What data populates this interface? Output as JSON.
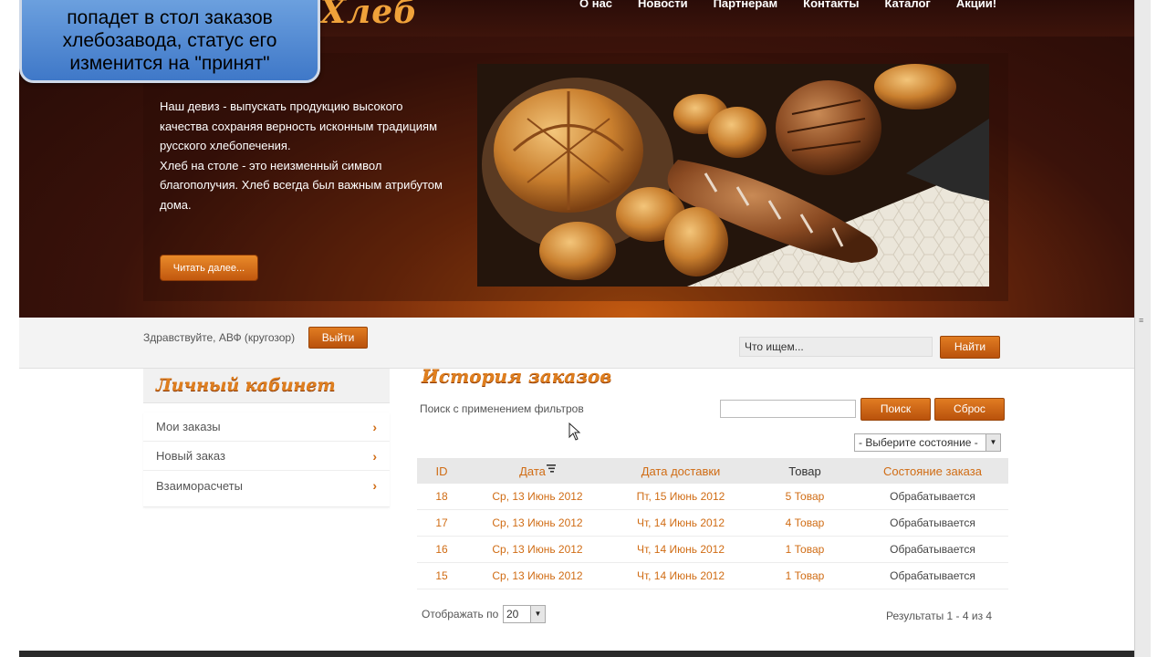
{
  "callout": {
    "text": "попадет в стол заказов хлебозавода, статус его изменится на \"принят\""
  },
  "header": {
    "logo_text": "Хлеб",
    "nav": [
      "О нас",
      "Новости",
      "Партнерам",
      "Контакты",
      "Каталог",
      "Акции!"
    ],
    "motto": [
      "Наш девиз - выпускать продукцию высокого качества сохраняя верность исконным традициям русского хлебопечения.",
      "Хлеб на столе - это неизменный символ благополучия. Хлеб всегда был важным атрибутом дома."
    ],
    "read_more": "Читать далее..."
  },
  "userbar": {
    "greeting": "Здравствуйте, АВФ (кругозор)",
    "logout": "Выйти",
    "search_value": "Что ищем...",
    "search_button": "Найти"
  },
  "sidebar": {
    "title": "Личный кабинет",
    "items": [
      {
        "label": "Мои заказы"
      },
      {
        "label": "Новый заказ"
      },
      {
        "label": "Взаиморасчеты"
      }
    ]
  },
  "orders": {
    "title": "История заказов",
    "filter_label": "Поиск с применением фильтров",
    "search_button": "Поиск",
    "reset_button": "Сброс",
    "state_select": "- Выберите состояние -",
    "columns": [
      "ID",
      "Дата",
      "Дата доставки",
      "Товар",
      "Состояние заказа"
    ],
    "rows": [
      {
        "id": "18",
        "date": "Ср, 13 Июнь 2012",
        "delivery": "Пт, 15 Июнь 2012",
        "goods": "5 Товар",
        "state": "Обрабатывается"
      },
      {
        "id": "17",
        "date": "Ср, 13 Июнь 2012",
        "delivery": "Чт, 14 Июнь 2012",
        "goods": "4 Товар",
        "state": "Обрабатывается"
      },
      {
        "id": "16",
        "date": "Ср, 13 Июнь 2012",
        "delivery": "Чт, 14 Июнь 2012",
        "goods": "1 Товар",
        "state": "Обрабатывается"
      },
      {
        "id": "15",
        "date": "Ср, 13 Июнь 2012",
        "delivery": "Чт, 14 Июнь 2012",
        "goods": "1 Товар",
        "state": "Обрабатывается"
      }
    ],
    "per_page_label": "Отображать по",
    "per_page_value": "20",
    "results": "Результаты 1 - 4 из 4"
  },
  "colors": {
    "accent": "#d06c14",
    "header_dark": "#2a0c08",
    "callout_blue": "#4f86d0"
  }
}
